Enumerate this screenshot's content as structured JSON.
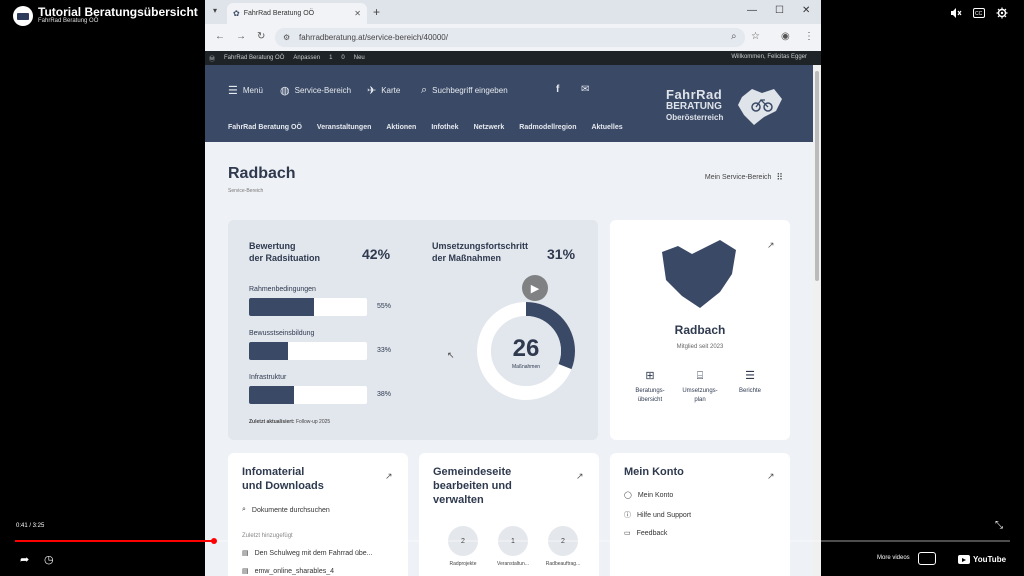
{
  "video": {
    "title": "Tutorial Beratungsübersicht",
    "channel": "FahrRad Beratung OÖ",
    "time": "0:41 / 3:25",
    "progress": 0.2,
    "more_videos": "More videos",
    "youtube": "YouTube"
  },
  "browser": {
    "tab_title": "FahrRad Beratung OÖ",
    "url": "fahrradberatung.at/service-bereich/40000/"
  },
  "wpbar": {
    "site": "FahrRad Beratung OÖ",
    "customize": "Anpassen",
    "updates": "1",
    "comments": "0",
    "new": "Neu",
    "welcome": "Willkommen, Felicitas Egger"
  },
  "header": {
    "menu": "Menü",
    "service": "Service-Bereich",
    "map": "Karte",
    "search": "Suchbegriff eingeben",
    "nav": [
      "FahrRad Beratung OÖ",
      "Veranstaltungen",
      "Aktionen",
      "Infothek",
      "Netzwerk",
      "Radmodellregion",
      "Aktuelles"
    ],
    "logo_line1": "FahrRad",
    "logo_line2": "BERATUNG",
    "logo_line3": "Oberösterreich"
  },
  "page": {
    "title": "Radbach",
    "breadcrumb": "Service-Bereich",
    "my_area": "Mein Service-Bereich"
  },
  "rating": {
    "title_line1": "Bewertung",
    "title_line2": "der Radsituation",
    "value": "42%",
    "bars": [
      {
        "label": "Rahmenbedingungen",
        "pct": "55%",
        "fraction": 0.55
      },
      {
        "label": "Bewusstseinsbildung",
        "pct": "33%",
        "fraction": 0.33
      },
      {
        "label": "Infrastruktur",
        "pct": "38%",
        "fraction": 0.38
      }
    ],
    "updated_label": "Zuletzt aktualisiert:",
    "updated_value": "Follow-up 2025"
  },
  "progress": {
    "title_line1": "Umsetzungsfortschritt",
    "title_line2": "der Maßnahmen",
    "value": "31%",
    "fraction": 0.31,
    "count": "26",
    "count_label": "Maßnahmen"
  },
  "community": {
    "name": "Radbach",
    "since": "Mitglied seit 2023",
    "links": [
      {
        "line1": "Beratungs-",
        "line2": "übersicht"
      },
      {
        "line1": "Umsetzungs-",
        "line2": "plan"
      },
      {
        "line1": "Berichte",
        "line2": ""
      }
    ]
  },
  "info": {
    "title_line1": "Infomaterial",
    "title_line2": "und Downloads",
    "search": "Dokumente durchsuchen",
    "recent": "Zuletzt hinzugefügt",
    "doc1": "Den Schulweg mit dem Fahrrad übe...",
    "doc2": "emw_online_sharables_4"
  },
  "community_page": {
    "title_line1": "Gemeindeseite",
    "title_line2": "bearbeiten und",
    "title_line3": "verwalten",
    "stats": [
      {
        "value": "2",
        "label": "Radprojekte"
      },
      {
        "value": "1",
        "label": "Veranstaltun..."
      },
      {
        "value": "2",
        "label": "Radbeauftrag..."
      }
    ]
  },
  "account": {
    "title": "Mein Konto",
    "items": [
      "Mein Konto",
      "Hilfe und Support",
      "Feedback"
    ]
  }
}
